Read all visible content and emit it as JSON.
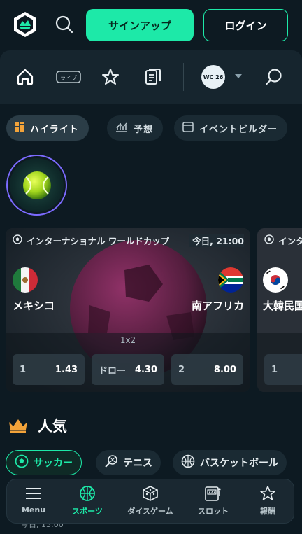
{
  "header": {
    "signup_label": "サインアップ",
    "login_label": "ログイン"
  },
  "nav": {
    "live_label": "ライブ",
    "wc_badge": "WC 26"
  },
  "tabs": [
    {
      "label": "ハイライト",
      "icon": "highlight-icon",
      "active": true
    },
    {
      "label": "予想",
      "icon": "prediction-icon",
      "active": false
    },
    {
      "label": "イベントビルダー",
      "icon": "event-builder-icon",
      "active": false
    }
  ],
  "story": {
    "icon": "tennis-ball-icon"
  },
  "match_card": {
    "league": "インターナショナル ワールドカップ",
    "time": "今日, 21:00",
    "home_team": "メキシコ",
    "away_team": "南アフリカ",
    "market": "1x2",
    "odds": [
      {
        "label": "1",
        "value": "1.43"
      },
      {
        "label": "ドロー",
        "value": "4.30"
      },
      {
        "label": "2",
        "value": "8.00"
      }
    ]
  },
  "next_card": {
    "league": "インタ",
    "team": "大韓民国",
    "odd_label": "1"
  },
  "popular": {
    "title": "人気",
    "chips": [
      {
        "label": "サッカー",
        "icon": "soccer-icon",
        "active": true
      },
      {
        "label": "テニス",
        "icon": "tennis-icon",
        "active": false
      },
      {
        "label": "バスケットボール",
        "icon": "basketball-icon",
        "active": false
      }
    ],
    "peek_text": "今日, 13:00"
  },
  "bottom_nav": [
    {
      "label": "Menu",
      "icon": "menu-icon",
      "active": false
    },
    {
      "label": "スポーツ",
      "icon": "sports-icon",
      "active": true
    },
    {
      "label": "ダイスゲーム",
      "icon": "dice-icon",
      "active": false
    },
    {
      "label": "スロット",
      "icon": "slot-icon",
      "active": false
    },
    {
      "label": "報酬",
      "icon": "reward-icon",
      "active": false
    }
  ],
  "colors": {
    "accent": "#1de9a8",
    "background": "#0d1a22",
    "panel": "#16252e"
  }
}
